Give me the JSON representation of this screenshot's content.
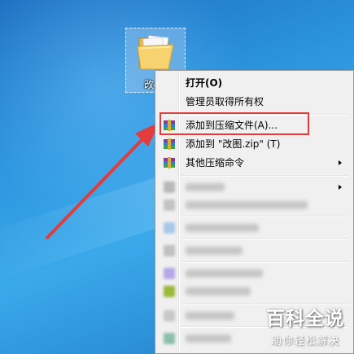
{
  "desktop": {
    "folder_label": "改"
  },
  "context_menu": {
    "items": [
      {
        "label": "打开(O)",
        "bold": true,
        "icon": "none"
      },
      {
        "label": "管理员取得所有权",
        "icon": "none"
      },
      {
        "label": "添加到压缩文件(A)...",
        "icon": "winrar-archive-icon"
      },
      {
        "label": "添加到 \"改图.zip\" (T)",
        "icon": "winrar-archive-icon"
      },
      {
        "label": "其他压缩命令",
        "icon": "winrar-archive-icon",
        "submenu": true
      }
    ],
    "blurred_rows": 8
  },
  "annotation": {
    "highlight_color": "#e43b3b",
    "arrow_color": "#e43b3b"
  },
  "watermark": {
    "main": "百科全说",
    "sub": "助你轻松解决"
  }
}
